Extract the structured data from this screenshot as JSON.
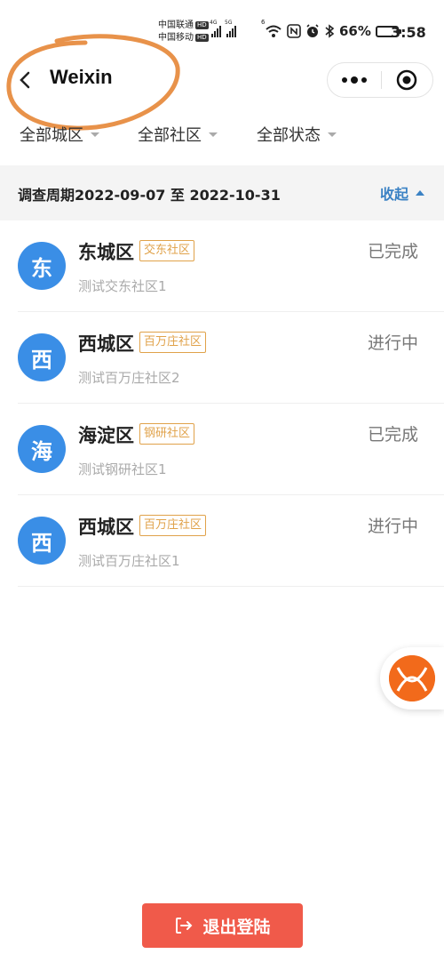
{
  "status_bar": {
    "carrier1": "中国联通",
    "carrier2": "中国移动",
    "hd": "HD",
    "net1": "4G",
    "net2": "5G",
    "wifi_gen": "6",
    "battery_pct": "66%",
    "battery_level": 0.66,
    "time": "3:58"
  },
  "navbar": {
    "title": "Weixin",
    "annotation_color": "#e8924a"
  },
  "filters": [
    {
      "label": "全部城区"
    },
    {
      "label": "全部社区"
    },
    {
      "label": "全部状态"
    }
  ],
  "period": {
    "text": "调查周期2022-09-07 至 2022-10-31",
    "collapse_label": "收起"
  },
  "items": [
    {
      "avatar": "东",
      "district": "东城区",
      "tag": "交东社区",
      "subtitle": "测试交东社区1",
      "status": "已完成"
    },
    {
      "avatar": "西",
      "district": "西城区",
      "tag": "百万庄社区",
      "subtitle": "测试百万庄社区2",
      "status": "进行中"
    },
    {
      "avatar": "海",
      "district": "海淀区",
      "tag": "钢研社区",
      "subtitle": "测试钢研社区1",
      "status": "已完成"
    },
    {
      "avatar": "西",
      "district": "西城区",
      "tag": "百万庄社区",
      "subtitle": "测试百万庄社区1",
      "status": "进行中"
    }
  ],
  "logout": {
    "label": "退出登陆"
  },
  "colors": {
    "accent_blue": "#3a8ee6",
    "link_blue": "#3b82c4",
    "tag_orange": "#e0a24a",
    "logout_red": "#f05a4a",
    "float_orange": "#f26a1b"
  }
}
